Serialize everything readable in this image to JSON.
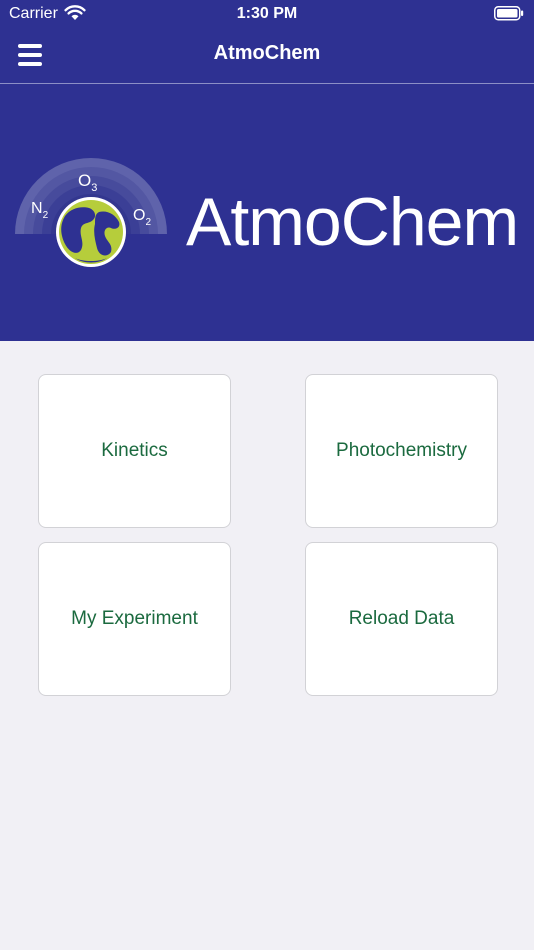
{
  "status_bar": {
    "carrier": "Carrier",
    "time": "1:30 PM"
  },
  "nav": {
    "title": "AtmoChem"
  },
  "banner": {
    "brand": "AtmoChem",
    "molecules": {
      "o3": "O",
      "o3_sub": "3",
      "n2": "N",
      "n2_sub": "2",
      "o2": "O",
      "o2_sub": "2"
    }
  },
  "menu": [
    {
      "label": "Kinetics"
    },
    {
      "label": "Photochemistry"
    },
    {
      "label": "My Experiment"
    },
    {
      "label": "Reload Data"
    }
  ],
  "colors": {
    "primary": "#2e3192",
    "tile_text": "#1b6a3f",
    "background": "#f1f0f5",
    "globe": "#b6cd3b"
  },
  "icons": [
    "wifi-icon",
    "battery-icon",
    "hamburger-menu-icon",
    "globe-logo"
  ]
}
